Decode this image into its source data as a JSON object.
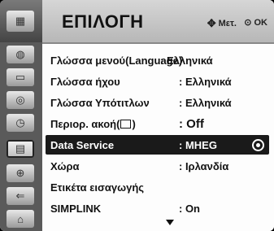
{
  "header": {
    "title": "ΕΠΙΛΟΓΗ",
    "move_hint": "Μετ.",
    "ok_hint": "OK"
  },
  "sidebar": {
    "icons": [
      "tv-icon",
      "globe-icon",
      "screen-icon",
      "disc-icon",
      "clock-icon",
      "option-icon",
      "lock-icon",
      "input-icon",
      "usb-icon"
    ],
    "active_index": 5
  },
  "menu": {
    "items": [
      {
        "label": "Γλώσσα μενού(Language)",
        "value": ": Ελληνικά"
      },
      {
        "label": "Γλώσσα ήχου",
        "value": ": Ελληνικά"
      },
      {
        "label": "Γλώσσα Υπότιτλων",
        "value": ": Ελληνικά"
      },
      {
        "label": "Περιορ. ακοή(",
        "label_suffix": ")",
        "value": ": Off"
      },
      {
        "label": "Data Service",
        "value": ": MHEG"
      },
      {
        "label": "Χώρα",
        "value": ": Ιρλανδία"
      },
      {
        "label": "Ετικέτα εισαγωγής",
        "value": ""
      },
      {
        "label": "SIMPLINK",
        "value": ": On"
      }
    ],
    "selected_index": 4
  },
  "colors": {
    "selected_bg": "#1a1a1a",
    "sidebar_bg": "#5a5a5a",
    "header_bg": "#c4c4c4"
  }
}
